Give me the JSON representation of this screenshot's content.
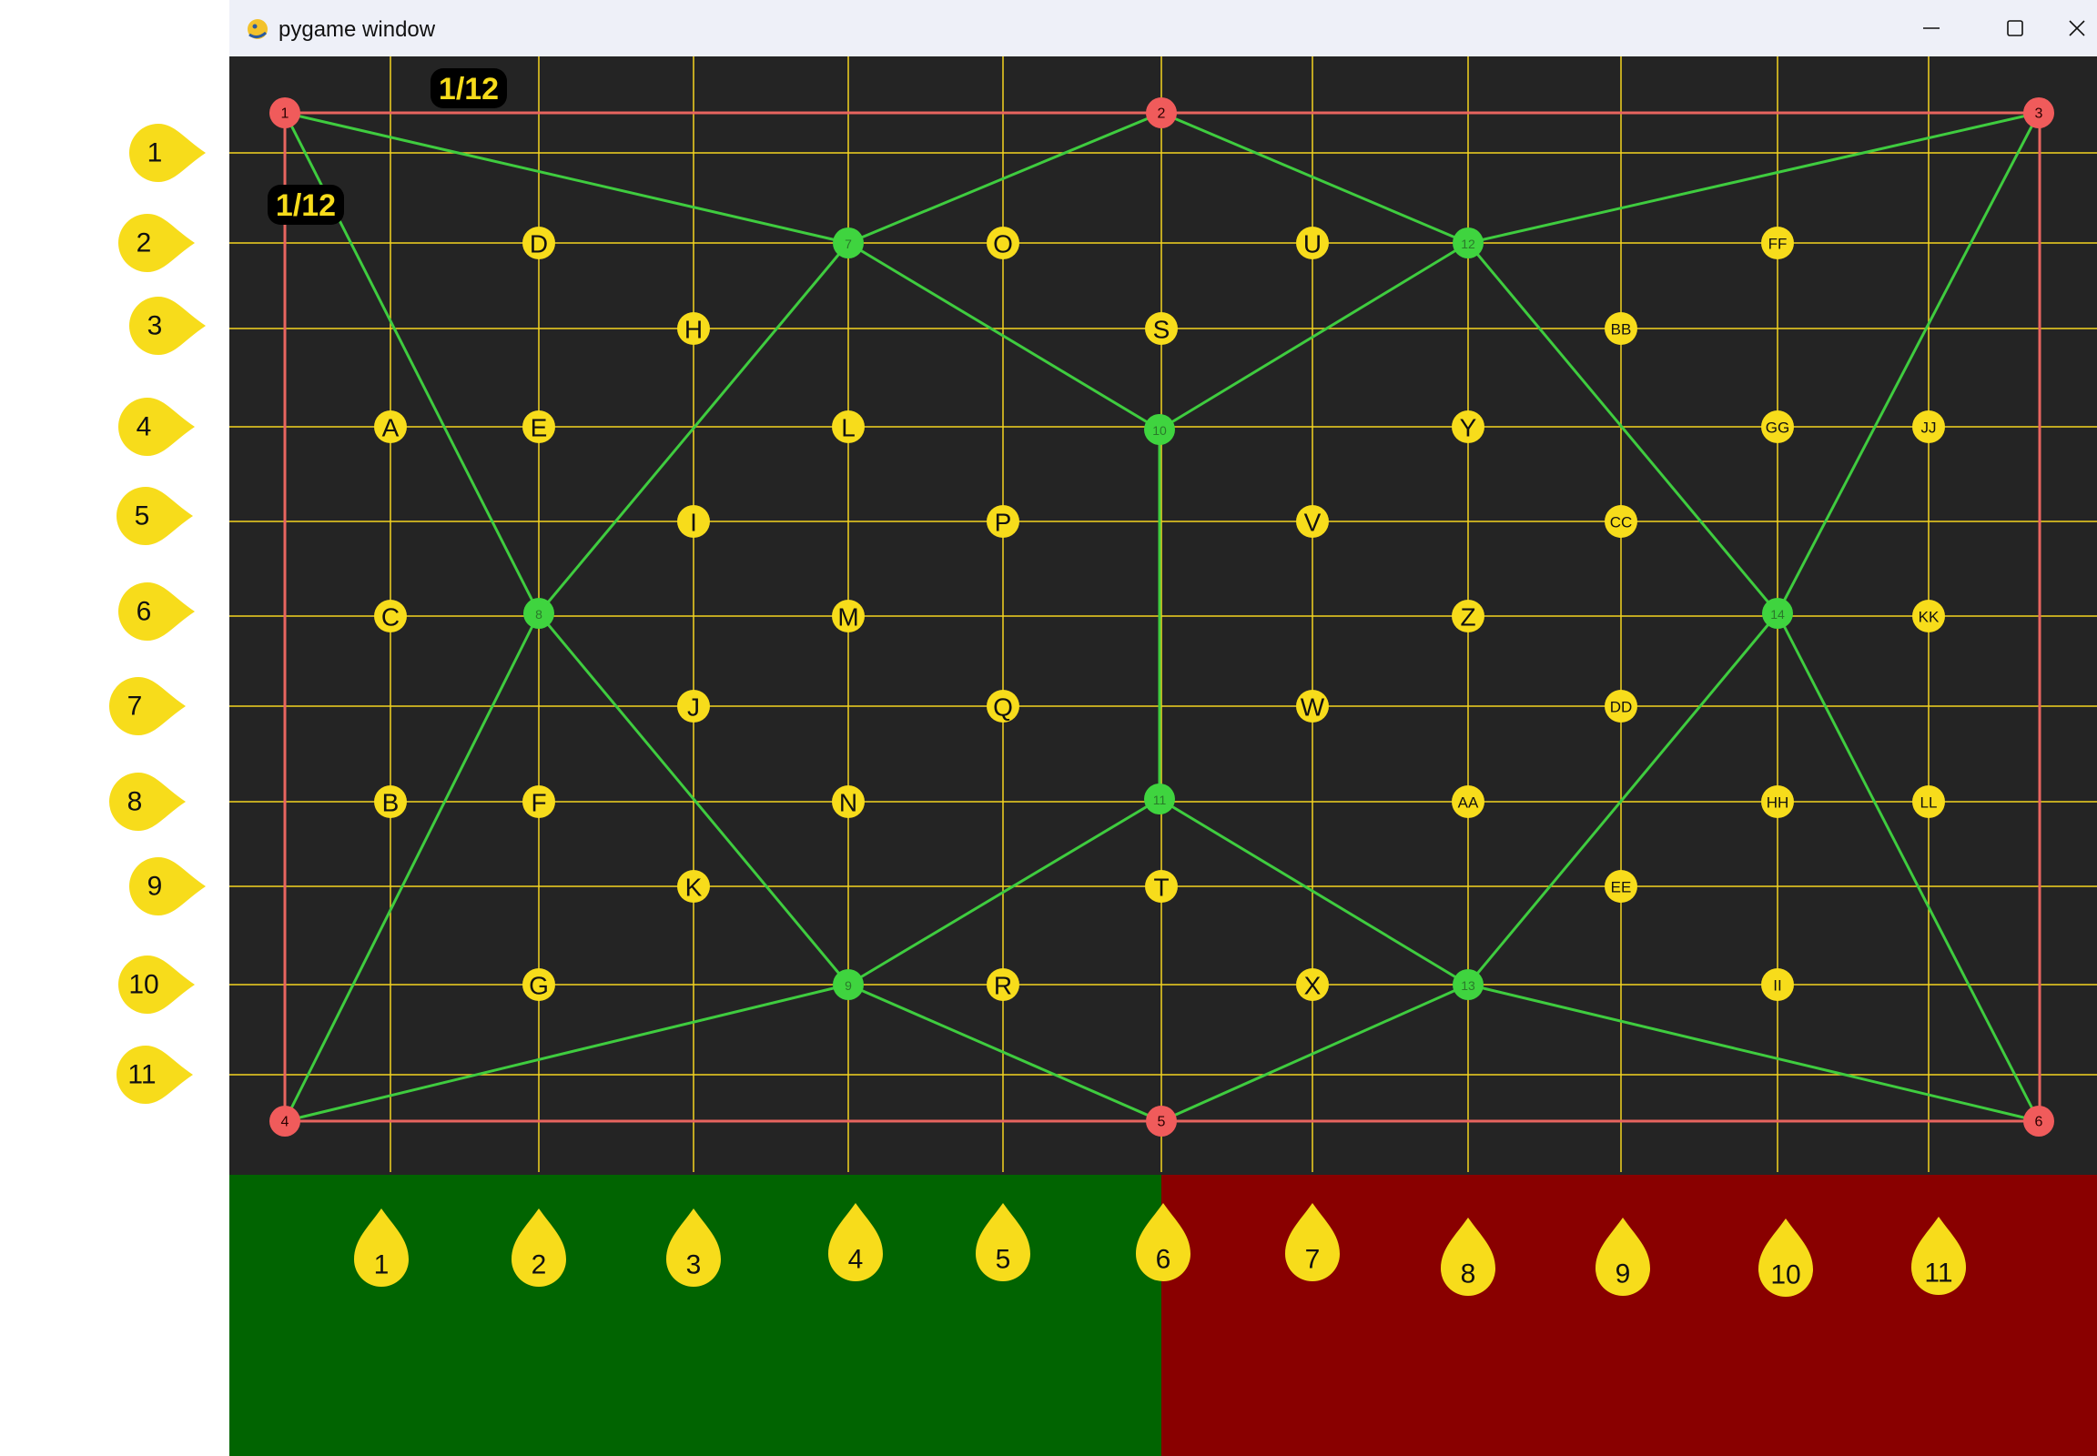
{
  "window": {
    "title": "pygame window"
  },
  "badges": [
    "1/12",
    "1/12"
  ],
  "row_labels": [
    "1",
    "2",
    "3",
    "4",
    "5",
    "6",
    "7",
    "8",
    "9",
    "10",
    "11"
  ],
  "col_labels": [
    "1",
    "2",
    "3",
    "4",
    "5",
    "6",
    "7",
    "8",
    "9",
    "10",
    "11"
  ],
  "corner_nodes": [
    "1",
    "2",
    "3",
    "4",
    "5",
    "6"
  ],
  "green_nodes": [
    "7",
    "8",
    "9",
    "10",
    "11",
    "12",
    "13",
    "14"
  ],
  "letter_nodes": [
    "A",
    "B",
    "C",
    "D",
    "E",
    "F",
    "G",
    "H",
    "I",
    "J",
    "K",
    "L",
    "M",
    "N",
    "O",
    "P",
    "Q",
    "R",
    "S",
    "T",
    "U",
    "V",
    "W",
    "X",
    "Y",
    "Z",
    "AA",
    "BB",
    "CC",
    "DD",
    "EE",
    "FF",
    "GG",
    "HH",
    "II",
    "JJ",
    "KK",
    "LL"
  ],
  "colors": {
    "canvas": "#242424",
    "grid": "#f4d320",
    "label": "#f7dc1b",
    "corner": "#f05b5b",
    "border": "#e8655f",
    "green_node": "#3fd43f",
    "edge": "#3fcc3f",
    "left_panel": "#016401",
    "right_panel": "#890000"
  }
}
